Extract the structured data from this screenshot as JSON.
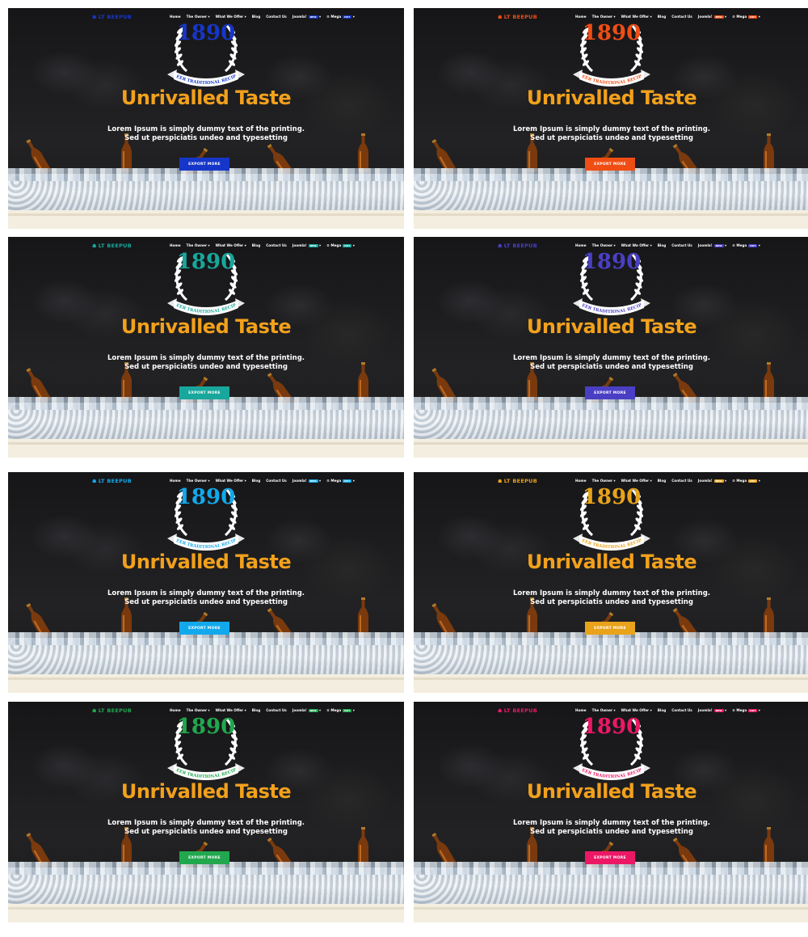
{
  "variants": [
    {
      "accent": "#1636c9"
    },
    {
      "accent": "#f04d14"
    },
    {
      "accent": "#17a79c"
    },
    {
      "accent": "#4a3fc4"
    },
    {
      "accent": "#12a9ec"
    },
    {
      "accent": "#e8a31a"
    },
    {
      "accent": "#21a84e"
    },
    {
      "accent": "#ec1866"
    }
  ],
  "common": {
    "logo": "LT BEEPUB",
    "nav": [
      "Home",
      "The Owner",
      "What We Offer",
      "Blog",
      "Contact Us",
      "Joomla!",
      "Mega"
    ],
    "badges": [
      "NEW",
      "HOT"
    ],
    "year": "1890",
    "ribbon": "BEER TRADITIONAL RECIPE",
    "title": "Unrivalled Taste",
    "desc_line1": "Lorem Ipsum is simply dummy text of the printing.",
    "desc_line2": "Sed ut perspiciatis undeo and typesetting",
    "button": "EXPORT MORE"
  },
  "colors": {
    "title": "#f2a11c",
    "background": "#1c1c1e",
    "cream": "#f4eee0"
  }
}
